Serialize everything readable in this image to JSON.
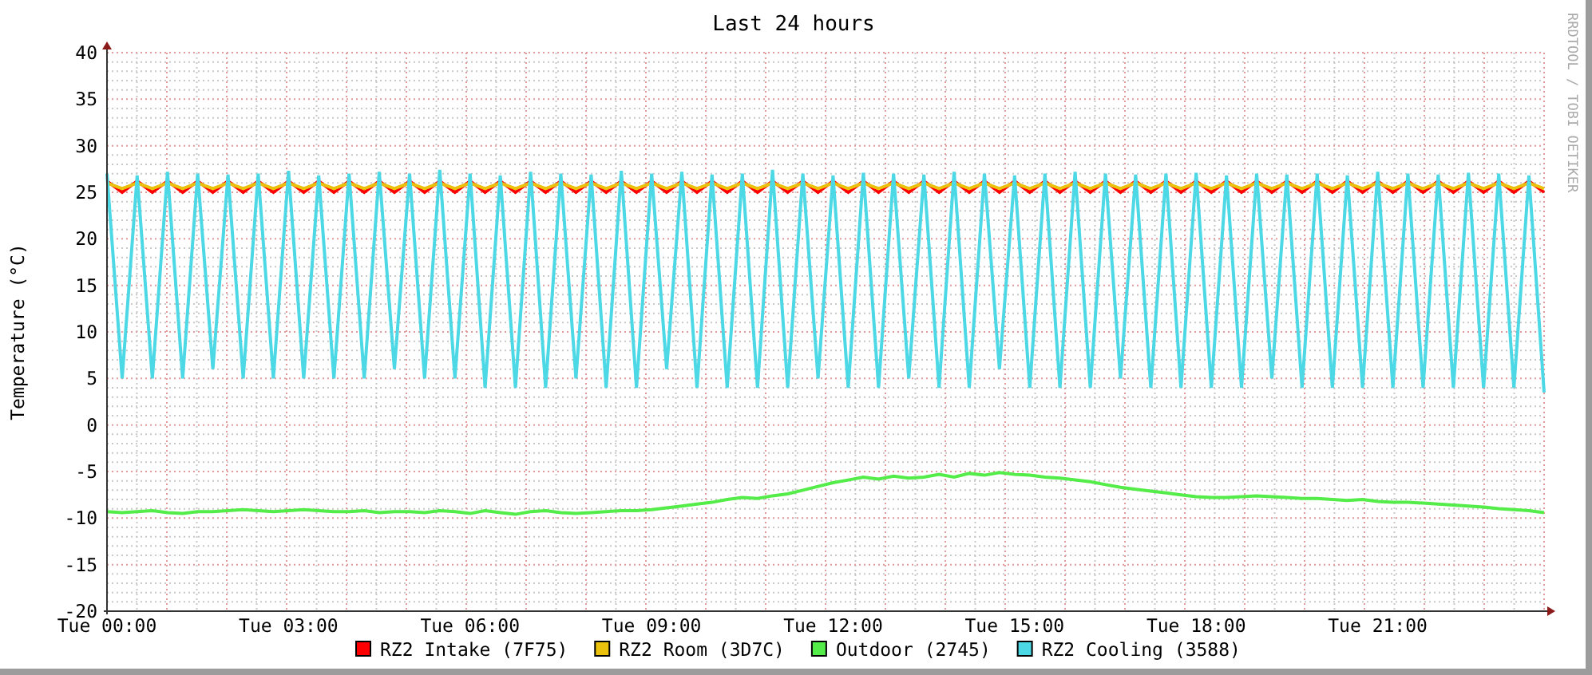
{
  "chart_data": {
    "type": "line",
    "title": "Last 24 hours",
    "ylabel": "Temperature (°C)",
    "ylim": [
      -20,
      40
    ],
    "grid": true,
    "legend": true,
    "yticks": [
      -20,
      -15,
      -10,
      -5,
      0,
      5,
      10,
      15,
      20,
      25,
      30,
      35,
      40
    ],
    "categories": [
      "Tue 00:00",
      null,
      null,
      null,
      null,
      null,
      null,
      null,
      null,
      null,
      null,
      null,
      "Tue 03:00",
      null,
      null,
      null,
      null,
      null,
      null,
      null,
      null,
      null,
      null,
      null,
      "Tue 06:00",
      null,
      null,
      null,
      null,
      null,
      null,
      null,
      null,
      null,
      null,
      null,
      "Tue 09:00",
      null,
      null,
      null,
      null,
      null,
      null,
      null,
      null,
      null,
      null,
      null,
      "Tue 12:00",
      null,
      null,
      null,
      null,
      null,
      null,
      null,
      null,
      null,
      null,
      null,
      "Tue 15:00",
      null,
      null,
      null,
      null,
      null,
      null,
      null,
      null,
      null,
      null,
      null,
      "Tue 18:00",
      null,
      null,
      null,
      null,
      null,
      null,
      null,
      null,
      null,
      null,
      null,
      "Tue 21:00",
      null,
      null,
      null,
      null,
      null,
      null,
      null,
      null,
      null,
      null,
      null
    ],
    "series": [
      {
        "name": "RZ2 Intake (7F75)",
        "color": "#ff0000",
        "values": [
          26.2,
          25.0,
          26.2,
          25.0,
          26.2,
          25.0,
          26.2,
          25.0,
          26.2,
          25.0,
          26.2,
          25.0,
          26.2,
          25.0,
          26.2,
          25.0,
          26.2,
          25.0,
          26.2,
          25.0,
          26.2,
          25.0,
          26.2,
          25.0,
          26.2,
          25.0,
          26.2,
          25.0,
          26.2,
          25.0,
          26.2,
          25.0,
          26.2,
          25.0,
          26.2,
          25.0,
          26.2,
          25.0,
          26.2,
          25.0,
          26.2,
          25.0,
          26.2,
          25.0,
          26.2,
          25.0,
          26.2,
          25.0,
          26.2,
          25.0,
          26.2,
          25.0,
          26.2,
          25.0,
          26.2,
          25.0,
          26.2,
          25.0,
          26.2,
          25.0,
          26.2,
          25.0,
          26.2,
          25.0,
          26.2,
          25.0,
          26.2,
          25.0,
          26.2,
          25.0,
          26.2,
          25.0,
          26.2,
          25.0,
          26.2,
          25.0,
          26.2,
          25.0,
          26.2,
          25.0,
          26.2,
          25.0,
          26.2,
          25.0,
          26.2,
          25.0,
          26.2,
          25.0,
          26.2,
          25.0,
          26.2,
          25.0,
          26.2,
          25.0,
          26.2,
          25.0
        ]
      },
      {
        "name": "RZ2 Room (3D7C)",
        "color": "#eac10c",
        "values": [
          26.0,
          25.4,
          26.0,
          25.4,
          26.0,
          25.4,
          26.0,
          25.4,
          26.0,
          25.4,
          26.0,
          25.4,
          26.0,
          25.4,
          26.0,
          25.4,
          26.0,
          25.4,
          26.0,
          25.4,
          26.0,
          25.4,
          26.0,
          25.4,
          26.0,
          25.4,
          26.0,
          25.4,
          26.0,
          25.4,
          26.0,
          25.4,
          26.0,
          25.4,
          26.0,
          25.4,
          26.0,
          25.4,
          26.0,
          25.4,
          26.0,
          25.4,
          26.0,
          25.4,
          26.0,
          25.4,
          26.0,
          25.4,
          26.0,
          25.4,
          26.0,
          25.4,
          26.0,
          25.4,
          26.0,
          25.4,
          26.0,
          25.4,
          26.0,
          25.4,
          26.0,
          25.4,
          26.0,
          25.4,
          26.0,
          25.4,
          26.0,
          25.4,
          26.0,
          25.4,
          26.0,
          25.4,
          26.0,
          25.4,
          26.0,
          25.4,
          26.0,
          25.4,
          26.0,
          25.4,
          26.0,
          25.4,
          26.0,
          25.4,
          26.0,
          25.4,
          26.0,
          25.4,
          26.0,
          25.4,
          26.0,
          25.4,
          26.0,
          25.4,
          26.0,
          25.4
        ]
      },
      {
        "name": "Outdoor (2745)",
        "color": "#54ec48",
        "values": [
          -9.3,
          -9.4,
          -9.3,
          -9.2,
          -9.4,
          -9.5,
          -9.3,
          -9.3,
          -9.2,
          -9.1,
          -9.2,
          -9.3,
          -9.2,
          -9.1,
          -9.2,
          -9.3,
          -9.3,
          -9.2,
          -9.4,
          -9.3,
          -9.3,
          -9.4,
          -9.2,
          -9.3,
          -9.5,
          -9.2,
          -9.4,
          -9.6,
          -9.3,
          -9.2,
          -9.4,
          -9.5,
          -9.4,
          -9.3,
          -9.2,
          -9.2,
          -9.1,
          -8.9,
          -8.7,
          -8.5,
          -8.3,
          -8.0,
          -7.8,
          -7.9,
          -7.6,
          -7.4,
          -7.0,
          -6.6,
          -6.2,
          -5.9,
          -5.6,
          -5.8,
          -5.5,
          -5.7,
          -5.6,
          -5.3,
          -5.6,
          -5.2,
          -5.4,
          -5.1,
          -5.3,
          -5.4,
          -5.6,
          -5.7,
          -5.9,
          -6.1,
          -6.4,
          -6.7,
          -6.9,
          -7.1,
          -7.3,
          -7.5,
          -7.7,
          -7.8,
          -7.8,
          -7.7,
          -7.6,
          -7.7,
          -7.8,
          -7.9,
          -7.9,
          -8.0,
          -8.1,
          -8.0,
          -8.2,
          -8.3,
          -8.3,
          -8.4,
          -8.5,
          -8.6,
          -8.7,
          -8.8,
          -9.0,
          -9.1,
          -9.2,
          -9.4
        ]
      },
      {
        "name": "RZ2 Cooling (3588)",
        "color": "#4dd8e6",
        "values": [
          27,
          5,
          26.8,
          5,
          27.2,
          5,
          27,
          6,
          26.9,
          5,
          27,
          5,
          27.3,
          5,
          26.8,
          5,
          27,
          5,
          27.2,
          6,
          27,
          5,
          27.4,
          5,
          27,
          4,
          26.8,
          4,
          27.2,
          4,
          27,
          5,
          26.9,
          4,
          27.3,
          4,
          27,
          6,
          27.2,
          4,
          26.9,
          4,
          27,
          4,
          27.4,
          4,
          27,
          5,
          26.8,
          4,
          27.1,
          4,
          27,
          5,
          26.9,
          4,
          27.2,
          4,
          27,
          6,
          26.8,
          4,
          27,
          4,
          27.2,
          4,
          27,
          5,
          26.9,
          4,
          27,
          4,
          27.1,
          4,
          26.8,
          4,
          27,
          5,
          26.9,
          4,
          27,
          4,
          26.8,
          4,
          27.2,
          4,
          27,
          4,
          26.9,
          4,
          27.1,
          4,
          27,
          4,
          26.8,
          3.5
        ]
      }
    ]
  },
  "credit": "RRDTOOL / TOBI OETIKER"
}
